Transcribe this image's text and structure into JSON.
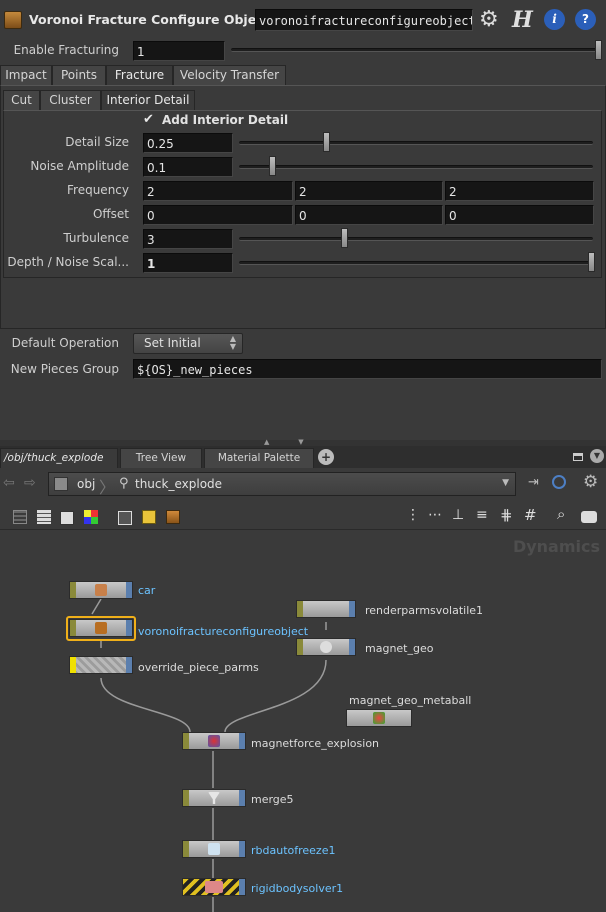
{
  "header": {
    "title": "Voronoi Fracture Configure Object",
    "op_name": "voronoifractureconfigureobject"
  },
  "enable_fracturing": {
    "label": "Enable Fracturing",
    "value": "1",
    "slider": 1.0
  },
  "main_tabs": [
    "Impact",
    "Points",
    "Fracture",
    "Velocity Transfer"
  ],
  "sub_tabs": [
    "Cut",
    "Cluster",
    "Interior Detail"
  ],
  "interior": {
    "checkbox_label": "Add Interior Detail",
    "detail_size": {
      "label": "Detail Size",
      "value": "0.25",
      "slider": 0.25
    },
    "noise_amplitude": {
      "label": "Noise Amplitude",
      "value": "0.1",
      "slider": 0.1
    },
    "frequency": {
      "label": "Frequency",
      "values": [
        "2",
        "2",
        "2"
      ]
    },
    "offset": {
      "label": "Offset",
      "values": [
        "0",
        "0",
        "0"
      ]
    },
    "turbulence": {
      "label": "Turbulence",
      "value": "3",
      "slider": 0.3
    },
    "depth_noise": {
      "label": "Depth / Noise Scal...",
      "value": "1",
      "slider": 1.0
    }
  },
  "default_operation": {
    "label": "Default Operation",
    "value": "Set Initial"
  },
  "new_pieces_group": {
    "label": "New Pieces Group",
    "value": "${OS}_new_pieces"
  },
  "network_tabs": [
    "/obj/thuck_explode",
    "Tree View",
    "Material Palette"
  ],
  "path": {
    "root": "obj",
    "current": "thuck_explode"
  },
  "watermark": "Dynamics",
  "nodes": [
    {
      "name": "car",
      "color": "#dcdcdc"
    },
    {
      "name": "voronoifractureconfigureobject",
      "color": "#6cc3ff"
    },
    {
      "name": "override_piece_parms",
      "color": "#dcdcdc"
    },
    {
      "name": "renderparmsvolatile1",
      "color": "#dcdcdc"
    },
    {
      "name": "magnet_geo",
      "color": "#dcdcdc"
    },
    {
      "name": "magnet_geo_metaball",
      "color": "#dcdcdc"
    },
    {
      "name": "magnetforce_explosion",
      "color": "#dcdcdc"
    },
    {
      "name": "merge5",
      "color": "#dcdcdc"
    },
    {
      "name": "rbdautofreeze1",
      "color": "#6cc3ff"
    },
    {
      "name": "rigidbodysolver1",
      "color": "#6cc3ff"
    }
  ]
}
